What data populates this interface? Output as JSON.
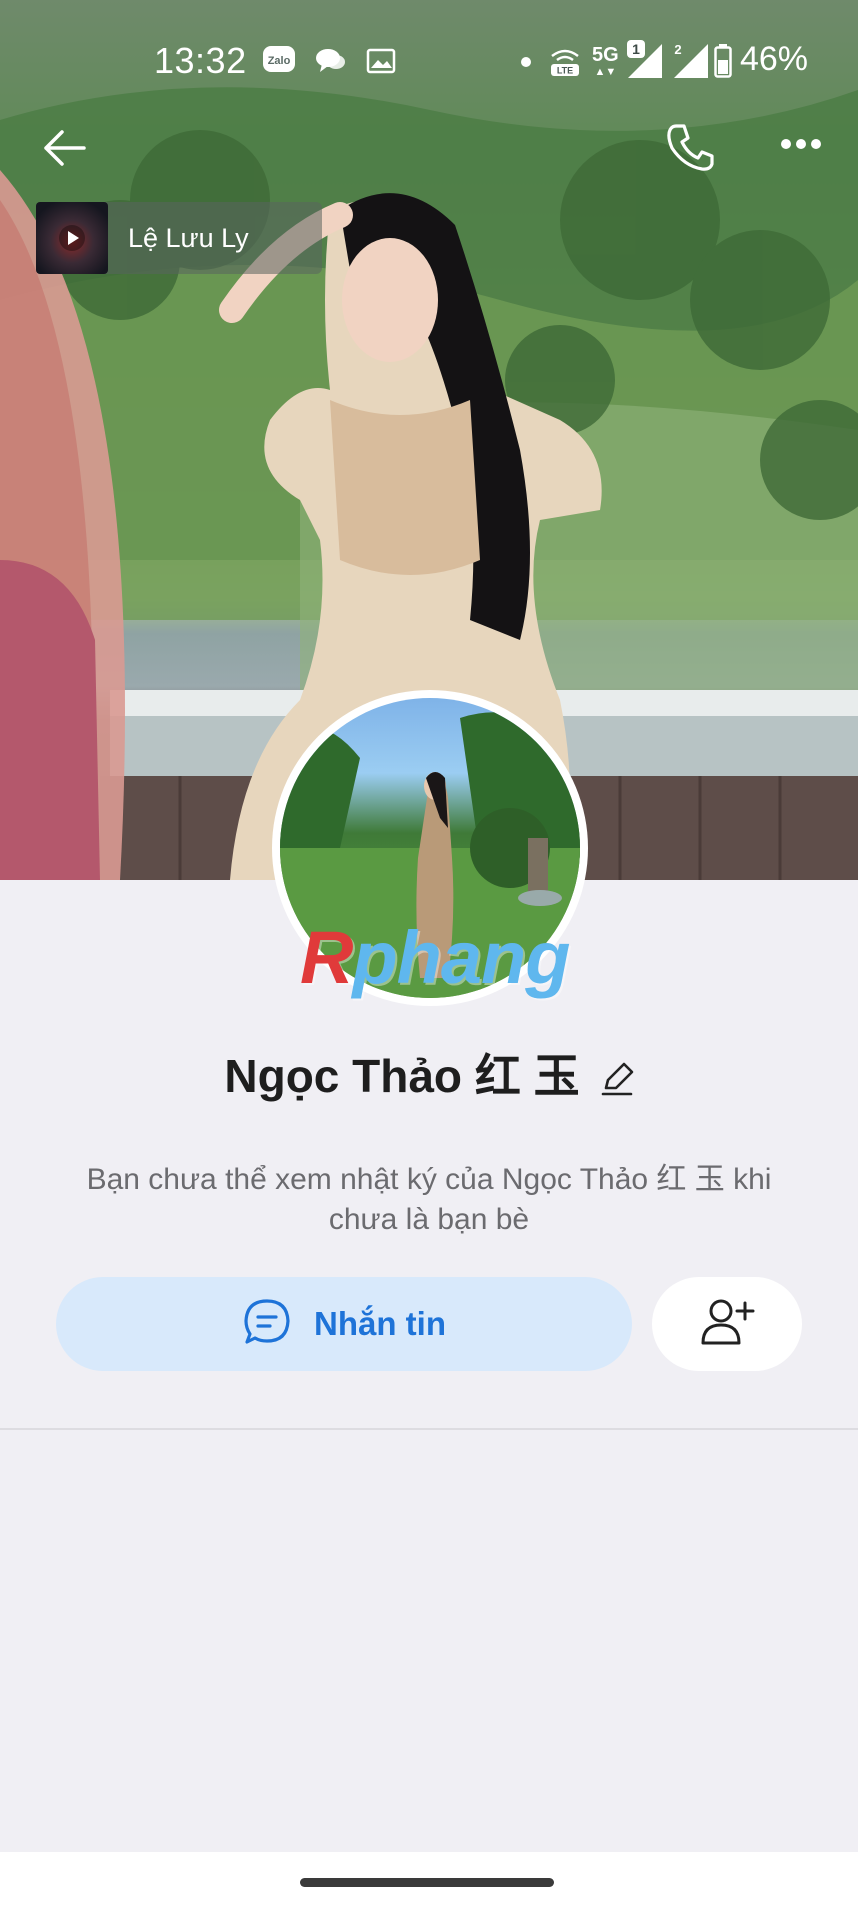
{
  "status_bar": {
    "time": "13:32",
    "battery_percent": "46%",
    "notification_icons": [
      "zalo-icon",
      "chat-bubbles-icon",
      "gallery-icon"
    ],
    "system_icons": [
      "dot-icon",
      "volte-icon",
      "5g-icon",
      "signal-sim1-icon",
      "signal-sim2-icon",
      "battery-icon"
    ],
    "sim1_label": "1",
    "sim2_label": "2",
    "network_label": "5G",
    "volte_label": "LTE",
    "zalo_label": "Zalo"
  },
  "header": {
    "back_icon": "arrow-left-icon",
    "call_icon": "phone-icon",
    "more_icon": "more-horizontal-icon"
  },
  "music": {
    "title": "Lệ Lưu Ly",
    "thumb_icon": "play-icon"
  },
  "watermark": {
    "first": "R",
    "rest": "phang"
  },
  "profile": {
    "name": "Ngọc Thảo 红 玉",
    "edit_icon": "pencil-icon",
    "privacy_note": "Bạn chưa thể xem nhật ký của Ngọc Thảo 红 玉 khi chưa là bạn bè"
  },
  "actions": {
    "message_label": "Nhắn tin",
    "message_icon": "chat-bubble-icon",
    "add_friend_icon": "add-friend-icon"
  },
  "colors": {
    "accent": "#1e73d8",
    "message_button_bg": "#d8e9fb",
    "page_bg": "#f0eff4"
  }
}
